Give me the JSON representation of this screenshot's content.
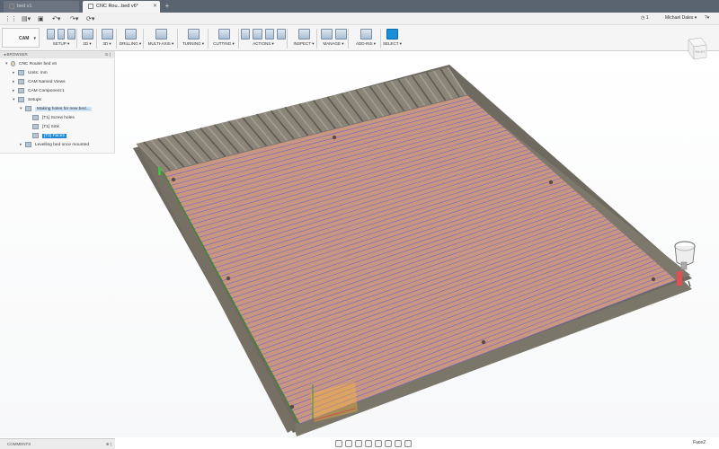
{
  "tabs": [
    {
      "label": "bed v1",
      "active": false
    },
    {
      "label": "CNC Rou...bed v6*",
      "active": true
    }
  ],
  "quick_access": {
    "clock": "1",
    "user": "Michael Dales",
    "help": "?"
  },
  "toolbar": {
    "workspace": "CAM",
    "groups": [
      {
        "label": "SETUP ▾",
        "icons": 3
      },
      {
        "label": "2D ▾",
        "icons": 1
      },
      {
        "label": "3D ▾",
        "icons": 1
      },
      {
        "label": "DRILLING ▾",
        "icons": 1
      },
      {
        "label": "MULTI-AXIS ▾",
        "icons": 1
      },
      {
        "label": "TURNING ▾",
        "icons": 1
      },
      {
        "label": "CUTTING ▾",
        "icons": 1
      },
      {
        "label": "ACTIONS ▾",
        "icons": 4
      },
      {
        "label": "INSPECT ▾",
        "icons": 1
      },
      {
        "label": "MANAGE ▾",
        "icons": 2
      },
      {
        "label": "ADD-INS ▾",
        "icons": 1
      },
      {
        "label": "SELECT ▾",
        "icons": 1
      }
    ]
  },
  "browser": {
    "title": "BROWSER",
    "items": [
      {
        "label": "CNC Router bed v6",
        "level": 0,
        "icon": "bulb",
        "state": "normal"
      },
      {
        "label": "Units: mm",
        "level": 1,
        "icon": "doc",
        "state": "normal"
      },
      {
        "label": "CAM Named Views",
        "level": 1,
        "icon": "folder",
        "state": "normal"
      },
      {
        "label": "CAM Component:1",
        "level": 1,
        "icon": "component",
        "state": "normal"
      },
      {
        "label": "Setups",
        "level": 1,
        "icon": "setups",
        "state": "normal"
      },
      {
        "label": "Making holes for new bed...",
        "level": 2,
        "icon": "setup",
        "state": "highlight"
      },
      {
        "label": "[T1] Screw holes",
        "level": 3,
        "icon": "op",
        "state": "normal"
      },
      {
        "label": "[T1] Sink",
        "level": 3,
        "icon": "op",
        "state": "normal"
      },
      {
        "label": "[T2] Face2",
        "level": 3,
        "icon": "op",
        "state": "selected"
      },
      {
        "label": "Levelling bed once mounted",
        "level": 2,
        "icon": "setup",
        "state": "normal"
      }
    ]
  },
  "comments_label": "COMMENTS",
  "status_text": "Face2",
  "viewcube_label": "RIGHT",
  "colors": {
    "tab_bar": "#5a6470",
    "selection": "#1f8bd8",
    "plank": "#c99682",
    "toolpath": "#6b63c7",
    "frame": "#6e6a60"
  }
}
